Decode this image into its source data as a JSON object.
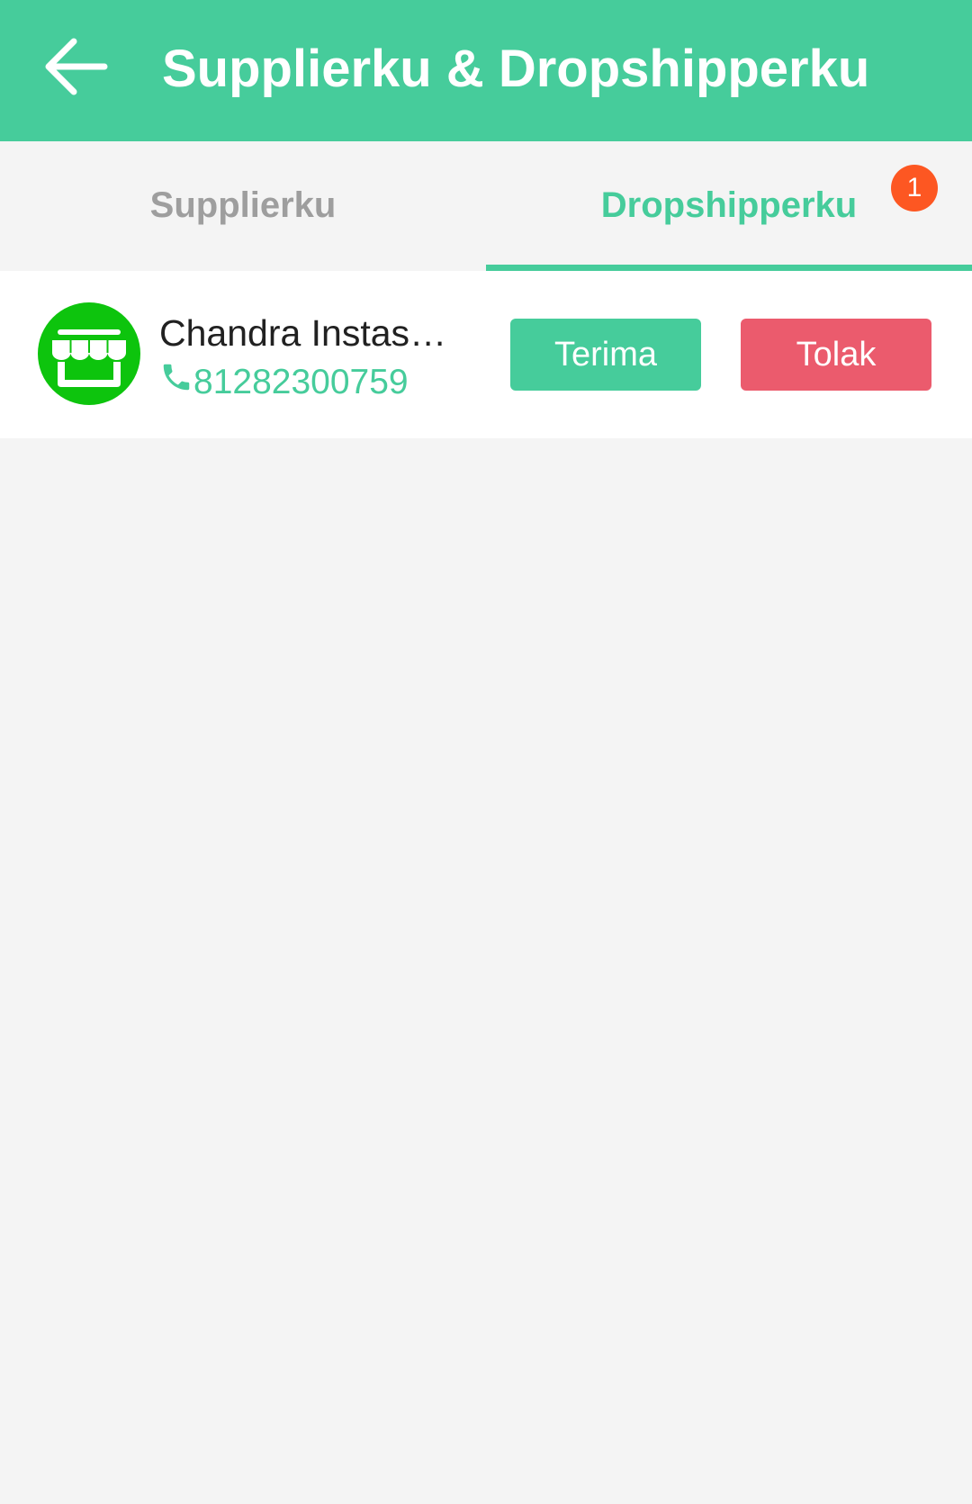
{
  "app_bar": {
    "back_icon": "arrow-left-icon",
    "title": "Supplierku &  Dropshipperku",
    "color": "#46cc9b"
  },
  "tabs": [
    {
      "label": "Supplierku",
      "selected": false
    },
    {
      "label": "Dropshipperku",
      "selected": true,
      "badge": "1"
    }
  ],
  "colors": {
    "accent": "#46cc9b",
    "reject": "#eb5b6d",
    "badge": "#fd5722",
    "avatar": "#0dc40d"
  },
  "requests": [
    {
      "avatar_icon": "store-icon",
      "name": "Chandra Instash…",
      "phone_icon": "phone-icon",
      "phone": "81282300759",
      "accept_label": "Terima",
      "reject_label": "Tolak"
    }
  ]
}
